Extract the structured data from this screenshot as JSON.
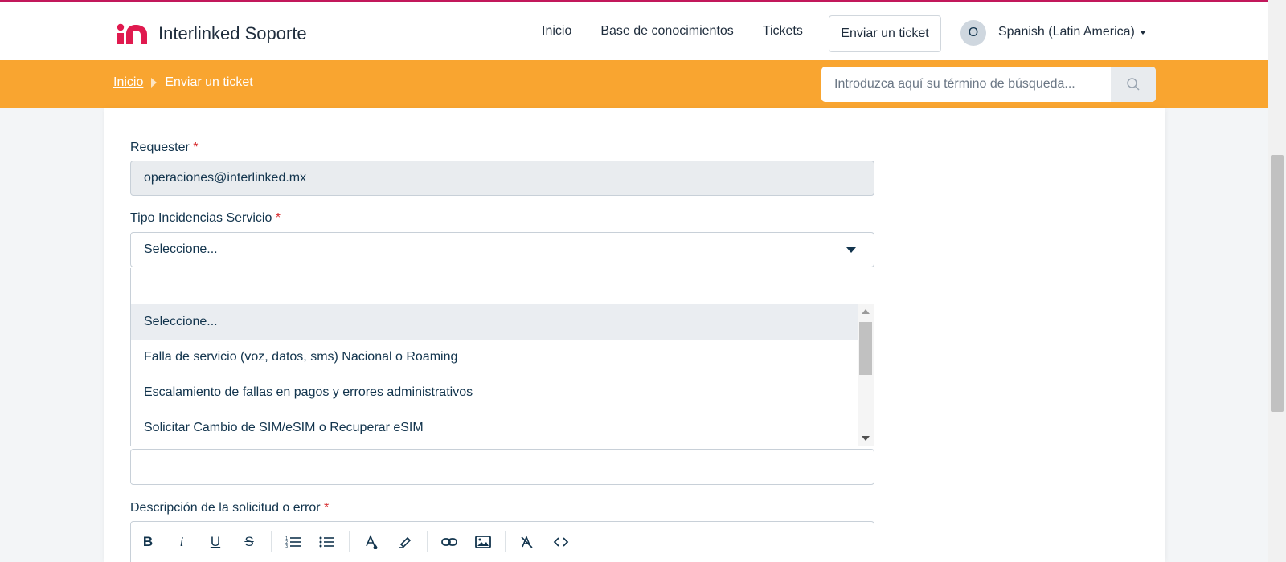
{
  "header": {
    "brand": "Interlinked Soporte",
    "nav": [
      "Inicio",
      "Base de conocimientos",
      "Tickets"
    ],
    "submit_ticket": "Enviar un ticket",
    "avatar_initial": "O",
    "language": "Spanish (Latin America)"
  },
  "breadcrumb": {
    "home": "Inicio",
    "current": "Enviar un ticket"
  },
  "search": {
    "placeholder": "Introduzca aquí su término de búsqueda..."
  },
  "form": {
    "requester_label": "Requester",
    "requester_value": "operaciones@interlinked.mx",
    "tipo_label": "Tipo Incidencias Servicio",
    "tipo_value": "Seleccione...",
    "tipo_options": [
      "Seleccione...",
      "Falla de servicio (voz, datos, sms) Nacional o Roaming",
      "Escalamiento de fallas en pagos y errores administrativos",
      "Solicitar Cambio de SIM/eSIM o Recuperar eSIM"
    ],
    "descripcion_label": "Descripción de la solicitud o error",
    "required_mark": "*"
  },
  "toolbar": {
    "bold": "B",
    "italic": "i",
    "underline": "U",
    "strike": "S",
    "icons": [
      "bold-icon",
      "italic-icon",
      "underline-icon",
      "strikethrough-icon",
      "ordered-list-icon",
      "unordered-list-icon",
      "font-color-icon",
      "highlight-icon",
      "link-icon",
      "image-icon",
      "clear-format-icon",
      "code-icon"
    ]
  },
  "colors": {
    "accent_bar": "#f9a530",
    "brand_red": "#e01a4f",
    "top_line": "#c2185b",
    "required": "#d72d30",
    "text": "#12344d"
  }
}
